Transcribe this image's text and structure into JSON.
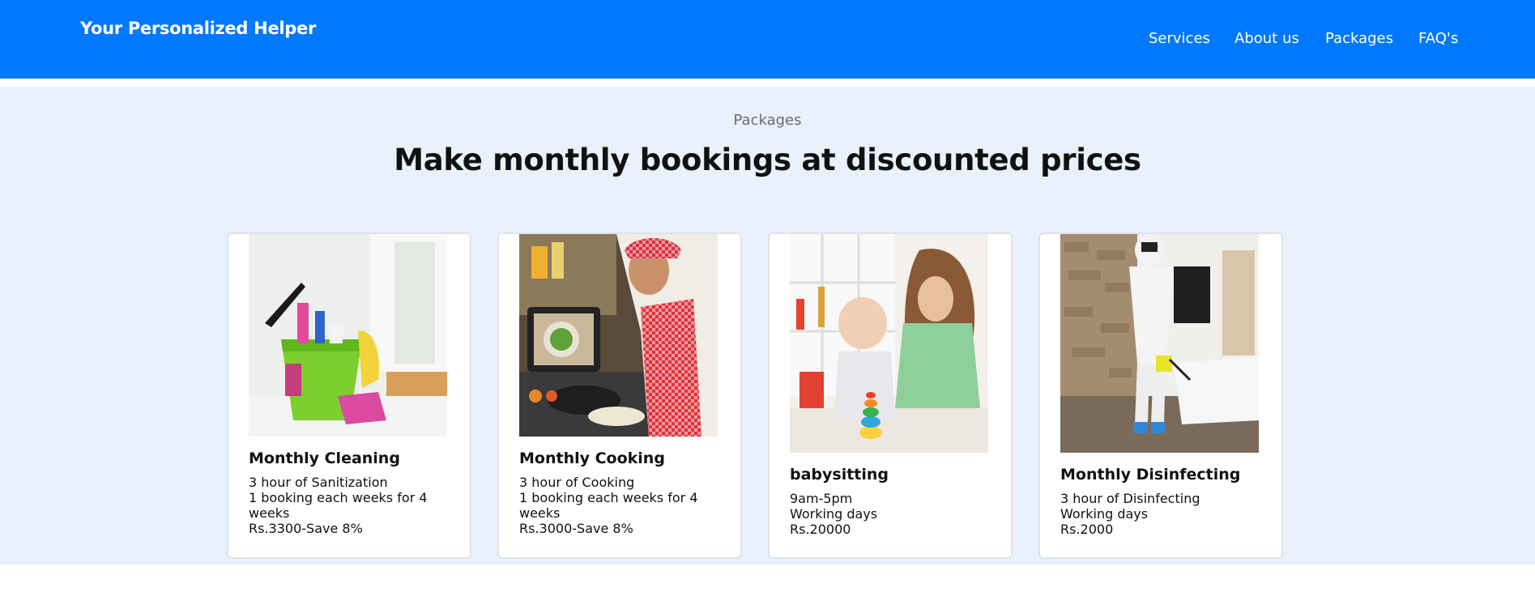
{
  "header": {
    "brand": "Your Personalized Helper",
    "nav": [
      {
        "label": "Services"
      },
      {
        "label": "About us"
      },
      {
        "label": "Packages"
      },
      {
        "label": "FAQ's"
      }
    ],
    "bg_color": "#0278fe"
  },
  "section": {
    "kicker": "Packages",
    "heading_bold": "Make monthly bookings",
    "heading_rest": " at discounted prices",
    "bg_color": "#e9f1fd"
  },
  "cards": [
    {
      "title": "Monthly Cleaning",
      "lines": [
        "3 hour of Sanitization",
        "1 booking each weeks for 4 weeks",
        "Rs.3300-Save 8%"
      ],
      "image": "cleaning-supplies-bucket-image"
    },
    {
      "title": "Monthly Cooking",
      "lines": [
        "3 hour of Cooking",
        "1 booking each weeks for 4 weeks",
        "Rs.3000-Save 8%"
      ],
      "image": "woman-cooking-image"
    },
    {
      "title": "babysitting",
      "lines": [
        "9am-5pm",
        "Working days",
        "Rs.20000"
      ],
      "image": "woman-with-baby-image"
    },
    {
      "title": "Monthly Disinfecting",
      "lines": [
        "3 hour of Disinfecting",
        "Working days",
        "Rs.2000"
      ],
      "image": "disinfection-worker-image"
    }
  ]
}
